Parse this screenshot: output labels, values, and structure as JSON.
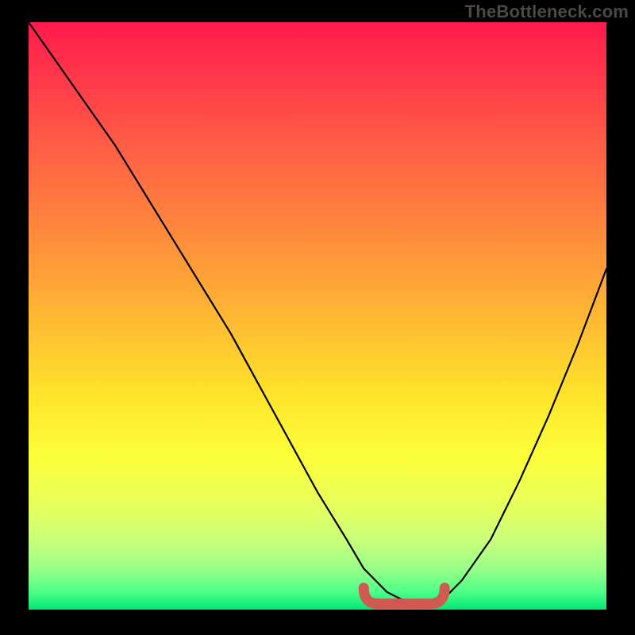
{
  "watermark": "TheBottleneck.com",
  "chart_data": {
    "type": "line",
    "title": "",
    "xlabel": "",
    "ylabel": "",
    "xlim": [
      0,
      100
    ],
    "ylim": [
      0,
      100
    ],
    "grid": false,
    "legend": false,
    "series": [
      {
        "name": "bottleneck-curve",
        "x": [
          0,
          5,
          10,
          15,
          20,
          25,
          30,
          35,
          40,
          45,
          50,
          55,
          58,
          62,
          66,
          70,
          72,
          75,
          80,
          85,
          90,
          95,
          100
        ],
        "y": [
          100,
          93,
          86,
          79,
          71,
          63,
          55,
          47,
          38,
          29,
          20,
          12,
          7,
          3,
          1,
          1,
          2,
          5,
          12,
          22,
          33,
          45,
          58
        ]
      }
    ],
    "highlight": {
      "name": "optimal-range",
      "x_start": 58,
      "x_end": 72,
      "y": 1,
      "color": "#cf5a52"
    },
    "background_gradient": [
      "#ff1a4b",
      "#ff6044",
      "#ffb733",
      "#fbff3a",
      "#99ff88",
      "#00e874"
    ]
  }
}
